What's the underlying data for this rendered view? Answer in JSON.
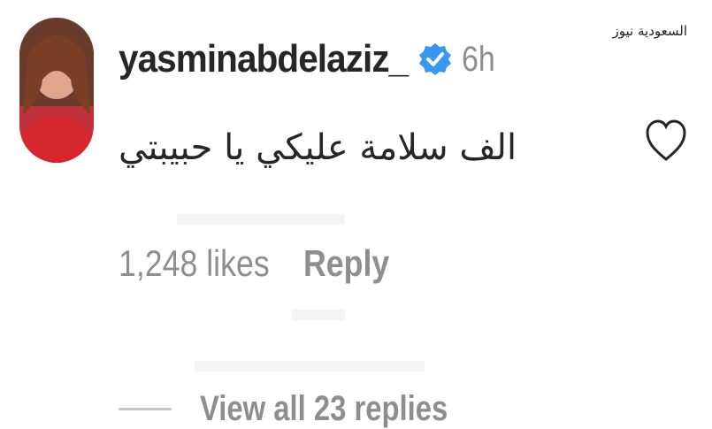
{
  "watermark": "السعودية نيوز",
  "comment": {
    "username": "yasminabdelaziz_",
    "time": "6h",
    "text": "الف سلامة عليكي يا حبيبتي",
    "likes": "1,248 likes",
    "reply_label": "Reply",
    "view_replies": "View all 23 replies"
  },
  "icons": {
    "verified": "verified-badge-icon",
    "like": "heart-outline-icon"
  },
  "colors": {
    "verified_blue": "#3897f0",
    "muted_text": "#8e8e8e",
    "primary_text": "#262626"
  }
}
